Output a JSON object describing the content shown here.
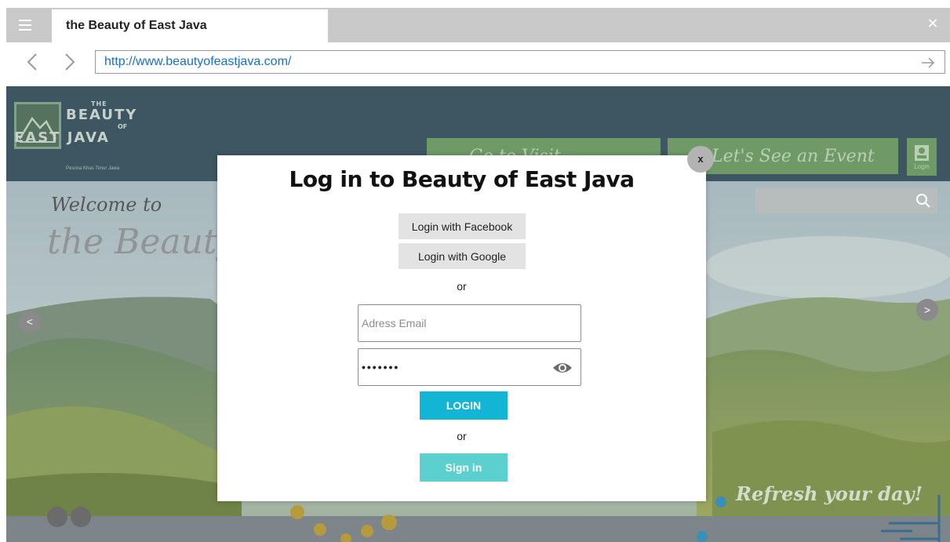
{
  "browser": {
    "tab_title": "the Beauty of East Java",
    "url": "http://www.beautyofeastjava.com/",
    "icons": [
      "menu-icon",
      "back-icon",
      "forward-icon",
      "go-icon",
      "close-icon"
    ]
  },
  "site": {
    "logo": {
      "line1": "THE",
      "line2": "BEAUTY",
      "line3": "OF",
      "line4": "EAST JAVA",
      "tagline": "Pesona Khas Timur Jawa"
    },
    "nav": {
      "button1_label": "Go to Visit",
      "button2_label": "Let's See an Event",
      "login_label": "Login"
    },
    "hero": {
      "welcome": "Welcome to",
      "script_title": "the Beauty",
      "prev": "<",
      "next": ">",
      "tagline": "Refresh your day!"
    },
    "colors": {
      "header": "#3e5661",
      "nav_button": "#6f9a67"
    }
  },
  "modal": {
    "close_label": "x",
    "title": "Log in to Beauty of East Java",
    "facebook_label": "Login with Facebook",
    "google_label": "Login with Google",
    "or1": "or",
    "email_placeholder": "Adress Email",
    "password_value": "•••••••",
    "login_label": "LOGIN",
    "or2": "or",
    "signin_label": "Sign in",
    "colors": {
      "login": "#12b5d3",
      "signin": "#5ccfcf"
    }
  }
}
